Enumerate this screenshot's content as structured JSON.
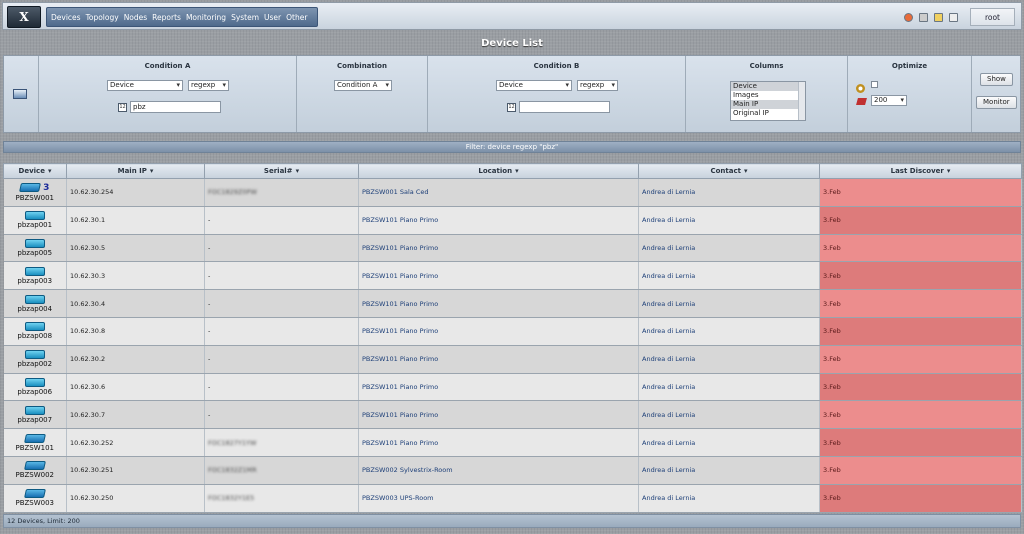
{
  "app": {
    "logo_text": "X",
    "menu": [
      "Devices",
      "Topology",
      "Nodes",
      "Reports",
      "Monitoring",
      "System",
      "User",
      "Other"
    ],
    "tool_icons": [
      "network-icon",
      "print-icon",
      "stats-icon",
      "mail-icon"
    ],
    "user": "root"
  },
  "page": {
    "title": "Device List"
  },
  "filter": {
    "condition_a": {
      "heading": "Condition A",
      "field": "Device",
      "operator": "regexp",
      "value": "pbz"
    },
    "combination": {
      "heading": "Combination",
      "value": "Condition A"
    },
    "condition_b": {
      "heading": "Condition B",
      "field": "Device",
      "operator": "regexp",
      "value": ""
    },
    "columns": {
      "heading": "Columns",
      "options": [
        "Device",
        "Images",
        "Main IP",
        "Original IP"
      ],
      "selected": [
        "Device",
        "Main IP"
      ]
    },
    "optimize": {
      "heading": "Optimize",
      "limit": "200"
    },
    "buttons": {
      "show": "Show",
      "monitor": "Monitor"
    }
  },
  "filter_summary": "Filter: device regexp \"pbz\"",
  "table": {
    "columns": [
      "Device",
      "Main IP",
      "Serial#",
      "Location",
      "Contact",
      "Last Discover"
    ],
    "rows": [
      {
        "device": "PBZSW001",
        "icon": "switch",
        "badge": "3",
        "ip": "10.62.30.254",
        "serial": "FOC1829Z0PW",
        "serial_redacted": true,
        "location": "PBZSW001 Sala Ced",
        "contact": "Andrea di Lernia",
        "last_discover": "3.Feb"
      },
      {
        "device": "pbzap001",
        "icon": "ap",
        "badge": "",
        "ip": "10.62.30.1",
        "serial": "-",
        "serial_redacted": false,
        "location": "PBZSW101 Piano Primo",
        "contact": "Andrea di Lernia",
        "last_discover": "3.Feb"
      },
      {
        "device": "pbzap005",
        "icon": "ap",
        "badge": "",
        "ip": "10.62.30.5",
        "serial": "-",
        "serial_redacted": false,
        "location": "PBZSW101 Piano Primo",
        "contact": "Andrea di Lernia",
        "last_discover": "3.Feb"
      },
      {
        "device": "pbzap003",
        "icon": "ap",
        "badge": "",
        "ip": "10.62.30.3",
        "serial": "-",
        "serial_redacted": false,
        "location": "PBZSW101 Piano Primo",
        "contact": "Andrea di Lernia",
        "last_discover": "3.Feb"
      },
      {
        "device": "pbzap004",
        "icon": "ap",
        "badge": "",
        "ip": "10.62.30.4",
        "serial": "-",
        "serial_redacted": false,
        "location": "PBZSW101 Piano Primo",
        "contact": "Andrea di Lernia",
        "last_discover": "3.Feb"
      },
      {
        "device": "pbzap008",
        "icon": "ap",
        "badge": "",
        "ip": "10.62.30.8",
        "serial": "-",
        "serial_redacted": false,
        "location": "PBZSW101 Piano Primo",
        "contact": "Andrea di Lernia",
        "last_discover": "3.Feb"
      },
      {
        "device": "pbzap002",
        "icon": "ap",
        "badge": "",
        "ip": "10.62.30.2",
        "serial": "-",
        "serial_redacted": false,
        "location": "PBZSW101 Piano Primo",
        "contact": "Andrea di Lernia",
        "last_discover": "3.Feb"
      },
      {
        "device": "pbzap006",
        "icon": "ap",
        "badge": "",
        "ip": "10.62.30.6",
        "serial": "-",
        "serial_redacted": false,
        "location": "PBZSW101 Piano Primo",
        "contact": "Andrea di Lernia",
        "last_discover": "3.Feb"
      },
      {
        "device": "pbzap007",
        "icon": "ap",
        "badge": "",
        "ip": "10.62.30.7",
        "serial": "-",
        "serial_redacted": false,
        "location": "PBZSW101 Piano Primo",
        "contact": "Andrea di Lernia",
        "last_discover": "3.Feb"
      },
      {
        "device": "PBZSW101",
        "icon": "switch",
        "badge": "",
        "ip": "10.62.30.252",
        "serial": "FOC1827Y1YW",
        "serial_redacted": true,
        "location": "PBZSW101 Piano Primo",
        "contact": "Andrea di Lernia",
        "last_discover": "3.Feb"
      },
      {
        "device": "PBZSW002",
        "icon": "switch",
        "badge": "",
        "ip": "10.62.30.251",
        "serial": "FOC1832Z1MR",
        "serial_redacted": true,
        "location": "PBZSW002 Sylvestrix-Room",
        "contact": "Andrea di Lernia",
        "last_discover": "3.Feb"
      },
      {
        "device": "PBZSW003",
        "icon": "switch",
        "badge": "",
        "ip": "10.62.30.250",
        "serial": "FOC1832Y1E5",
        "serial_redacted": true,
        "location": "PBZSW003 UPS-Room",
        "contact": "Andrea di Lernia",
        "last_discover": "3.Feb"
      }
    ]
  },
  "status": "12 Devices, Limit: 200"
}
